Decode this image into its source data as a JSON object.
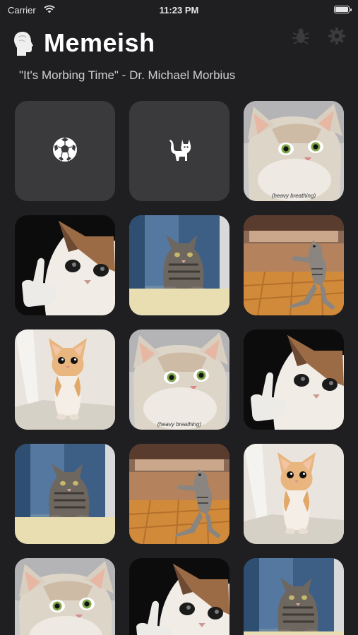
{
  "status_bar": {
    "carrier": "Carrier",
    "time": "11:23 PM"
  },
  "header": {
    "title": "Memeish",
    "subtitle": "\"It's Morbing Time\" - Dr. Michael Morbius",
    "app_icon": "head-profile-icon",
    "actions": [
      {
        "name": "bug-icon"
      },
      {
        "name": "gear-icon"
      }
    ]
  },
  "grid": {
    "action_tiles": [
      {
        "icon": "soccer-ball-icon"
      },
      {
        "icon": "cat-icon"
      }
    ],
    "meme_tiles": [
      {
        "meme": "heavy-breathing-cat",
        "caption": "(heavy breathing)"
      },
      {
        "meme": "crying-thumbs-up-cat",
        "caption": ""
      },
      {
        "meme": "cat-at-table",
        "caption": ""
      },
      {
        "meme": "dancing-cat",
        "caption": ""
      },
      {
        "meme": "standing-kitten",
        "caption": ""
      },
      {
        "meme": "heavy-breathing-cat",
        "caption": "(heavy breathing)"
      },
      {
        "meme": "crying-thumbs-up-cat",
        "caption": ""
      },
      {
        "meme": "cat-at-table",
        "caption": ""
      },
      {
        "meme": "dancing-cat",
        "caption": ""
      },
      {
        "meme": "standing-kitten",
        "caption": ""
      },
      {
        "meme": "heavy-breathing-cat",
        "caption": ""
      },
      {
        "meme": "crying-thumbs-up-cat",
        "caption": ""
      },
      {
        "meme": "cat-at-table",
        "caption": ""
      }
    ]
  },
  "colors": {
    "background": "#1f1f21",
    "tile": "#3a3a3d"
  }
}
